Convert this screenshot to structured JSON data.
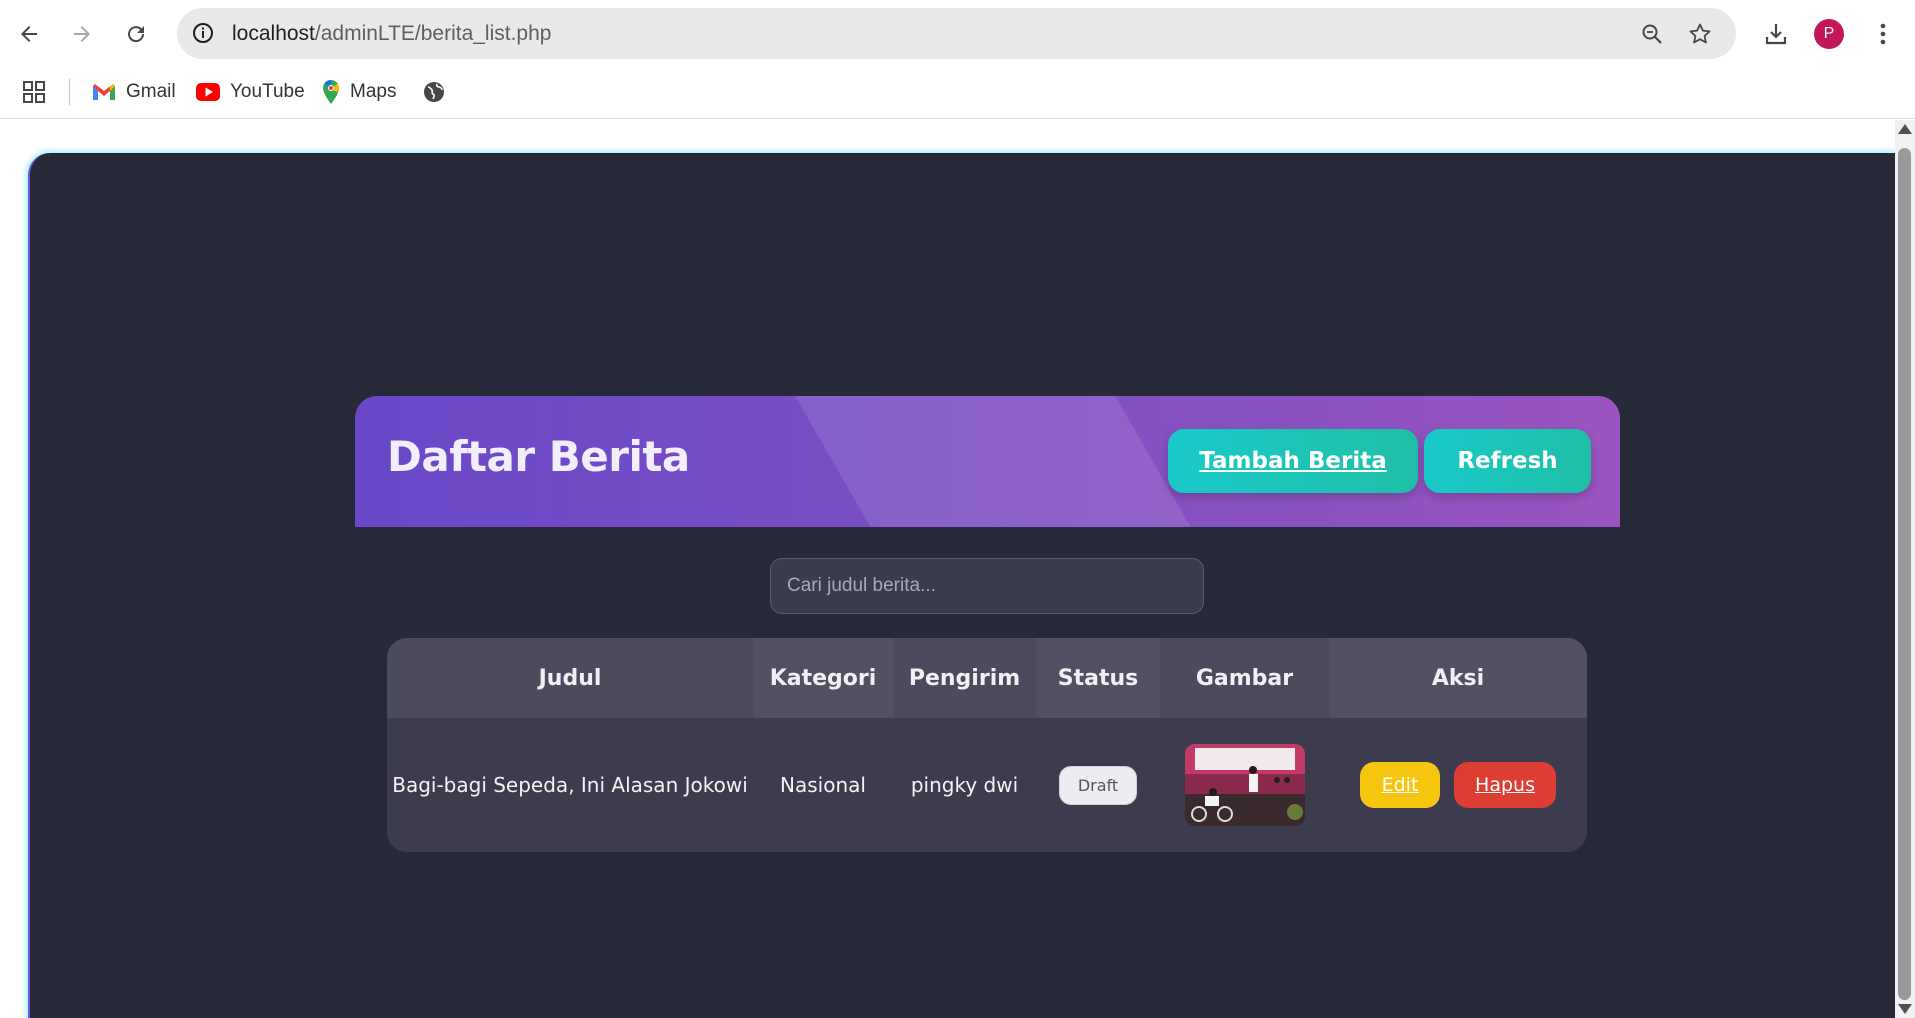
{
  "browser": {
    "url_host": "localhost",
    "url_path": "/adminLTE/berita_list.php",
    "profile_initial": "P",
    "bookmarks": [
      {
        "label": "Gmail"
      },
      {
        "label": "YouTube"
      },
      {
        "label": "Maps"
      }
    ]
  },
  "page": {
    "title": "Daftar Berita",
    "add_button": "Tambah Berita",
    "refresh_button": "Refresh",
    "search_placeholder": "Cari judul berita...",
    "table": {
      "headers": [
        "Judul",
        "Kategori",
        "Pengirim",
        "Status",
        "Gambar",
        "Aksi"
      ],
      "rows": [
        {
          "judul": "Bagi-bagi Sepeda, Ini Alasan Jokowi",
          "kategori": "Nasional",
          "pengirim": "pingky dwi",
          "status": "Draft",
          "edit": "Edit",
          "hapus": "Hapus"
        }
      ]
    }
  },
  "colors": {
    "background": "#272838",
    "header_gradient_start": "#6a48c8",
    "header_gradient_end": "#9a55c0",
    "teal": "#19c9c9",
    "edit": "#f6c510",
    "delete": "#dc3e33"
  }
}
